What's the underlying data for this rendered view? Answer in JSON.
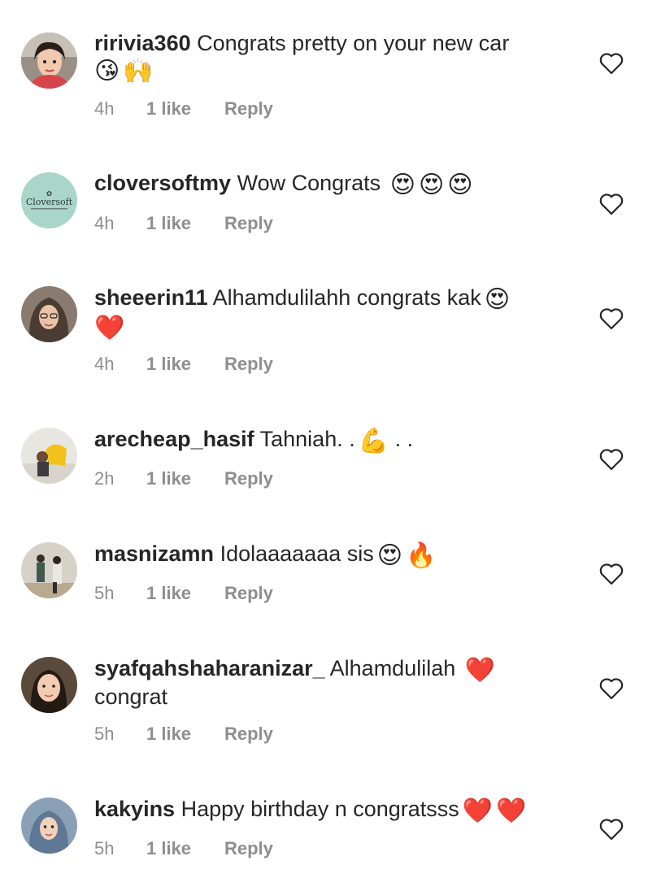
{
  "comments": [
    {
      "username": "ririvia360",
      "text": "Congrats pretty on your new car",
      "emojis": [
        "😘",
        "🙌"
      ],
      "time": "4h",
      "likes": "1 like",
      "reply": "Reply"
    },
    {
      "username": "cloversoftmy",
      "text": "Wow Congrats",
      "emojis": [
        "😍",
        "😍",
        "😍"
      ],
      "time": "4h",
      "likes": "1 like",
      "reply": "Reply",
      "avatar_text": "Cloversoft"
    },
    {
      "username": "sheeerin11",
      "text": "Alhamdulilahh congrats kak",
      "emojis": [
        "😍",
        "❤️"
      ],
      "time": "4h",
      "likes": "1 like",
      "reply": "Reply"
    },
    {
      "username": "arecheap_hasif",
      "text": "Tahniah. .",
      "emojis": [
        "💪"
      ],
      "text_after": ". .",
      "time": "2h",
      "likes": "1 like",
      "reply": "Reply"
    },
    {
      "username": "masnizamn",
      "text": "Idolaaaaaaa sis",
      "emojis": [
        "😍",
        "🔥"
      ],
      "time": "5h",
      "likes": "1 like",
      "reply": "Reply"
    },
    {
      "username": "syafqahshaharanizar_",
      "text": "Alhamdulilah",
      "emojis": [
        "❤️"
      ],
      "text_after": "congrat",
      "time": "5h",
      "likes": "1 like",
      "reply": "Reply"
    },
    {
      "username": "kakyins",
      "text": "Happy birthday n congratsss",
      "emojis": [
        "❤️",
        "❤️"
      ],
      "time": "5h",
      "likes": "1 like",
      "reply": "Reply"
    }
  ],
  "icons": {
    "like": "heart-outline-icon"
  },
  "colors": {
    "text": "#262626",
    "secondary": "#8e8e8e",
    "heart_emoji": "#e0142a"
  }
}
